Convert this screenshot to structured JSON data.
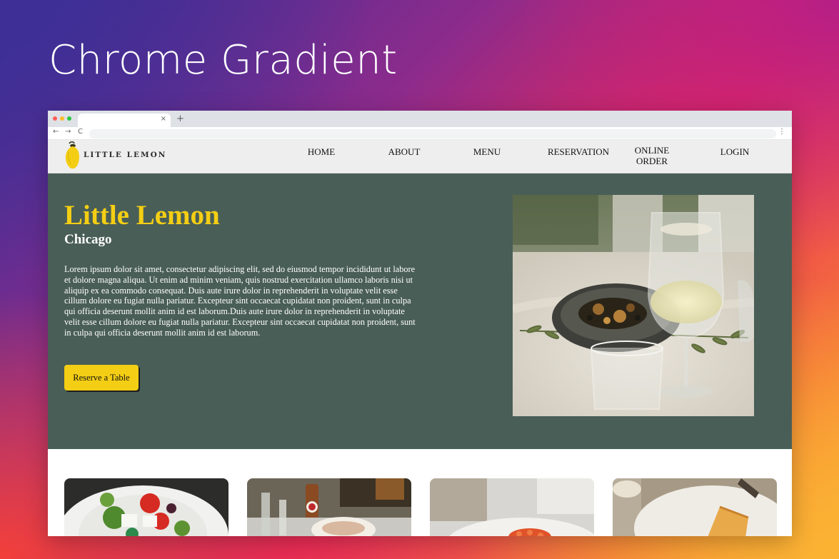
{
  "showcase": {
    "title": "Chrome Gradient"
  },
  "browser": {
    "tab_close": "×",
    "new_tab": "+",
    "icons": {
      "back": "←",
      "forward": "→",
      "reload": "C",
      "menu": "⋮"
    }
  },
  "site": {
    "logo_text": "LITTLE LEMON",
    "nav": [
      {
        "label": "HOME"
      },
      {
        "label": "ABOUT"
      },
      {
        "label": "MENU"
      },
      {
        "label": "RESERVATION"
      },
      {
        "label_line1": "ONLINE",
        "label_line2": "ORDER"
      },
      {
        "label": "LOGIN"
      }
    ],
    "hero": {
      "title": "Little Lemon",
      "subtitle": "Chicago",
      "text": "Lorem ipsum dolor sit amet, consectetur adipiscing elit, sed do eiusmod tempor incididunt ut labore et dolore magna aliqua. Ut enim ad minim veniam, quis nostrud exercitation ullamco laboris nisi ut aliquip ex ea commodo consequat. Duis aute irure dolor in reprehenderit in voluptate velit esse cillum dolore eu fugiat nulla pariatur. Excepteur sint occaecat cupidatat non proident, sunt in culpa qui officia deserunt mollit anim id est laborum.Duis aute irure dolor in reprehenderit in voluptate velit esse cillum dolore eu fugiat nulla pariatur. Excepteur sint occaecat cupidatat non proident, sunt in culpa qui officia deserunt mollit anim id est laborum.",
      "cta": "Reserve a Table"
    }
  },
  "colors": {
    "brand_green": "#495e57",
    "brand_yellow": "#f4ce14",
    "nav_bg": "#eeeeee"
  }
}
